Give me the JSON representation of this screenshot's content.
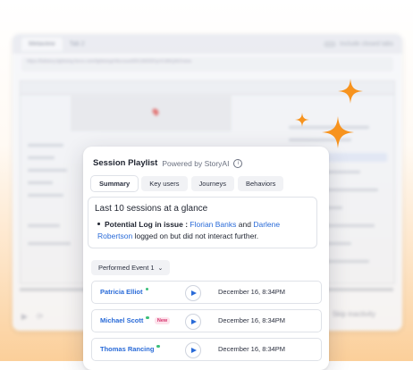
{
  "background_app": {
    "tab_label": "Metaview",
    "tab2_label": "Tab 2",
    "toggle_label": "Include closed tabs",
    "url": "https://fullstory.lightning.force.com/lightning/r/Account/0013t00001pVLWbQAO/view",
    "inactivity_label": "Skip inactivity"
  },
  "card": {
    "title": "Session Playlist",
    "powered_by": "Powered by StoryAI",
    "info_icon": "info-icon",
    "tabs": [
      {
        "label": "Summary",
        "active": true
      },
      {
        "label": "Key users",
        "active": false
      },
      {
        "label": "Journeys",
        "active": false
      },
      {
        "label": "Behaviors",
        "active": false
      }
    ],
    "summary": {
      "heading": "Last 10 sessions at a glance",
      "bullet_label": "Potential Log in issue :",
      "user1": "Florian Banks",
      "conjunction": "and",
      "user2": "Darlene Robertson",
      "rest": "logged on but did not interact further."
    },
    "event_filter": {
      "label": "Performed Event 1",
      "icon": "chevron-down-icon"
    },
    "sessions": [
      {
        "name": "Patricia Elliot",
        "online": true,
        "badge": "",
        "time": "December 16, 8:34PM"
      },
      {
        "name": "Michael Scott",
        "online": true,
        "badge": "New",
        "time": "December 16, 8:34PM"
      },
      {
        "name": "Thomas Rancing",
        "online": true,
        "badge": "",
        "time": "December 16, 8:34PM"
      }
    ]
  },
  "colors": {
    "accent_blue": "#2a6bd8",
    "sparkle_orange": "#f7931e",
    "online_green": "#3bbf7a",
    "new_badge_pink": "#d6336c"
  }
}
